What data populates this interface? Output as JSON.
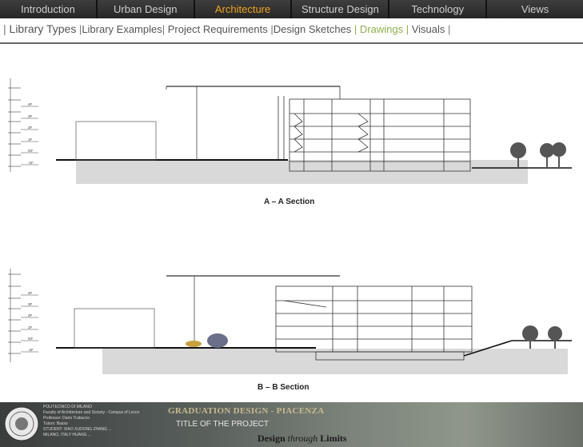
{
  "nav": {
    "tabs": [
      {
        "label": "Introduction"
      },
      {
        "label": "Urban Design"
      },
      {
        "label": "Architecture",
        "active": true
      },
      {
        "label": "Structure Design"
      },
      {
        "label": "Technology"
      },
      {
        "label": "Views"
      }
    ]
  },
  "breadcrumb": {
    "items": [
      {
        "label": "Library Types"
      },
      {
        "label": "Library Examples"
      },
      {
        "label": "Project Requirements"
      },
      {
        "label": "Design Sketches"
      },
      {
        "label": "Drawings",
        "active": true
      },
      {
        "label": "Visuals"
      }
    ]
  },
  "drawings": {
    "section_a": {
      "caption": "A – A   Section",
      "levels": [
        "4F",
        "3F",
        "2F",
        "1F",
        "GF",
        "-1F"
      ]
    },
    "section_b": {
      "caption": "B – B  Section",
      "levels": [
        "4F",
        "3F",
        "2F",
        "1F",
        "GF",
        "-1F"
      ]
    }
  },
  "footer": {
    "institution_lines": [
      "POLITECNICO DI MILANO",
      "Faculty of Architecture and Society - Campus of Lecco",
      "Professor: Dario Trabucco",
      "Tutors: Basso",
      "STUDENT: XIAO XUDONG  ZHANG  ...",
      "MILANO, ITALY  HUANG ..."
    ],
    "graduation_title": "GRADUATION DESIGN - PIACENZA",
    "project_title": "TITLE OF THE PROJECT",
    "motto_a": "Design ",
    "motto_b": "through",
    "motto_c": " Limits"
  },
  "colors": {
    "nav_bg": "#2f2f2f",
    "nav_text": "#cfcfcf",
    "nav_active": "#f0a321",
    "breadcrumb_active": "#8db04b",
    "ground_fill": "#d9d9d9"
  }
}
